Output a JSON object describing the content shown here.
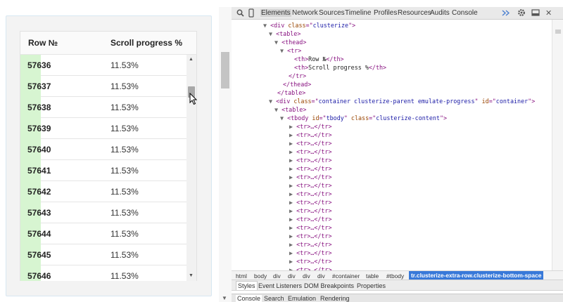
{
  "demo": {
    "headers": {
      "row": "Row №",
      "scroll": "Scroll progress %"
    },
    "rows": [
      {
        "num": "57636",
        "pct": "11.53%"
      },
      {
        "num": "57637",
        "pct": "11.53%"
      },
      {
        "num": "57638",
        "pct": "11.53%"
      },
      {
        "num": "57639",
        "pct": "11.53%"
      },
      {
        "num": "57640",
        "pct": "11.53%"
      },
      {
        "num": "57641",
        "pct": "11.53%"
      },
      {
        "num": "57642",
        "pct": "11.53%"
      },
      {
        "num": "57643",
        "pct": "11.53%"
      },
      {
        "num": "57644",
        "pct": "11.53%"
      },
      {
        "num": "57645",
        "pct": "11.53%"
      },
      {
        "num": "57646",
        "pct": "11.53%"
      }
    ]
  },
  "devtools": {
    "tabs": [
      "Elements",
      "Network",
      "Sources",
      "Timeline",
      "Profiles",
      "Resources",
      "Audits",
      "Console"
    ],
    "active_tab": "Elements",
    "tree": {
      "div1": {
        "tag": "div",
        "attr": "class",
        "val": "clusterize"
      },
      "table": "<table>",
      "thead": "<thead>",
      "tr": "<tr>",
      "th_row_open": "<th>",
      "th_row_text": "Row №",
      "th_row_close": "</th>",
      "th_scroll_open": "<th>",
      "th_scroll_text": "Scroll progress %",
      "th_scroll_close": "</th>",
      "tr_close": "</tr>",
      "thead_close": "</thead>",
      "table_close": "</table>",
      "div2": {
        "tag": "div",
        "attr1": "class",
        "val1": "container clusterize-parent emulate-progress",
        "attr2": "id",
        "val2": "container"
      },
      "table2": "<table>",
      "tbody": {
        "tag": "tbody",
        "attr1": "id",
        "val1": "tbody",
        "attr2": "class",
        "val2": "clusterize-content"
      },
      "tr_collapsed": "<tr>…</tr>"
    },
    "breadcrumbs": [
      "html",
      "body",
      "div",
      "div",
      "div",
      "div",
      "#container",
      "table",
      "#tbody"
    ],
    "breadcrumb_selected": "tr.clusterize-extra-row.clusterize-bottom-space",
    "style_tabs": [
      "Styles",
      "Event Listeners",
      "DOM Breakpoints",
      "Properties"
    ],
    "drawer_tabs": [
      "Console",
      "Search",
      "Emulation",
      "Rendering"
    ],
    "icons": [
      "search-icon",
      "device-icon",
      "settings-icon",
      "dock-icon",
      "close-icon",
      "execute-icon"
    ]
  }
}
